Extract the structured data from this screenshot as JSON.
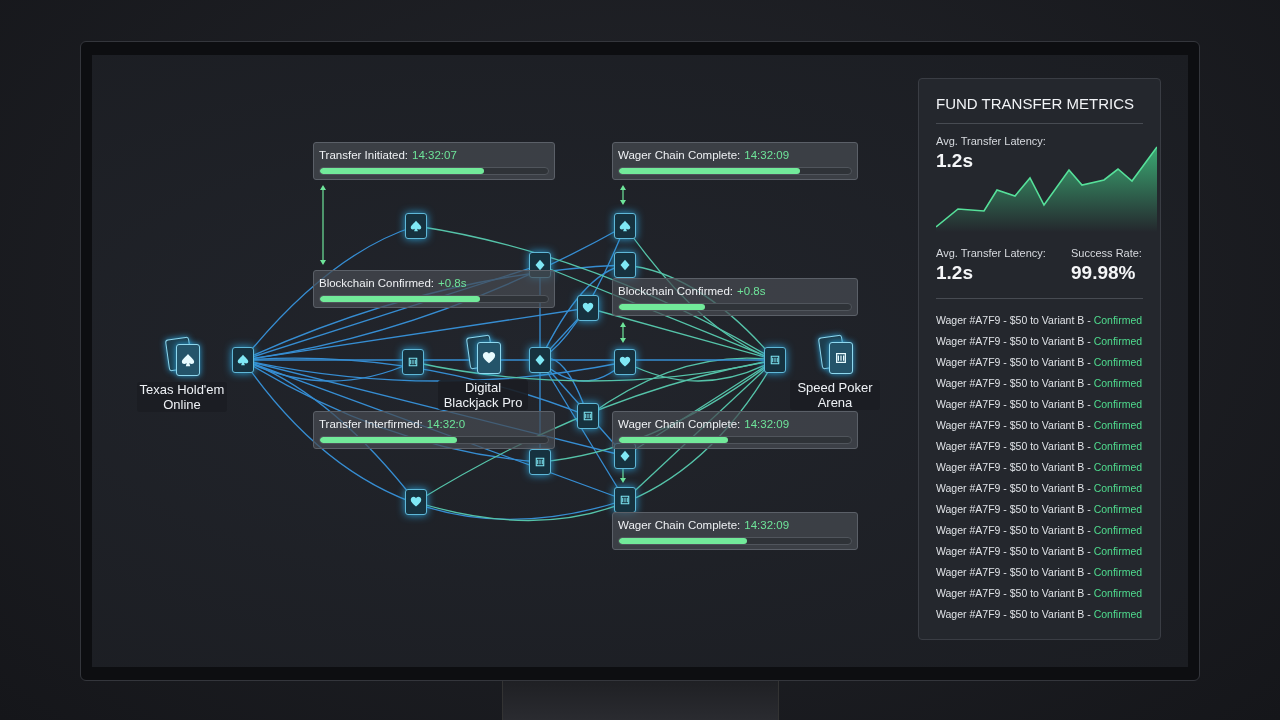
{
  "diagram": {
    "sources": [
      {
        "name": "Texas Hold'em Online"
      },
      {
        "name": "Digital Blackjack Pro"
      },
      {
        "name": "Speed Poker Arena"
      }
    ],
    "status_cards": [
      {
        "label": "Transfer Initiated:",
        "value": "14:32:07",
        "level": 0.72
      },
      {
        "label": "Wager Chain Complete:",
        "value": "14:32:09",
        "level": 0.78
      },
      {
        "label": "Blockchain Confirmed:",
        "value": "+0.8s",
        "level": 0.7
      },
      {
        "label": "Blockchain Confirmed:",
        "value": "+0.8s",
        "level": 0.37
      },
      {
        "label": "Transfer Interfirmed:",
        "value": "14:32:0",
        "level": 0.6
      },
      {
        "label": "Wager Chain Complete:",
        "value": "14:32:09",
        "level": 0.47
      },
      {
        "label": "Wager Chain Complete:",
        "value": "14:32:09",
        "level": 0.55
      }
    ]
  },
  "panel": {
    "title": "FUND TRANSFER METRICS",
    "hero_metric": {
      "label": "Avg. Transfer Latency:",
      "value": "1.2s"
    },
    "metrics": [
      {
        "label": "Avg. Transfer Latency:",
        "value": "1.2s"
      },
      {
        "label": "Success Rate:",
        "value": "99.98%"
      }
    ],
    "log": [
      {
        "text": "Wager #A7F9 - $50 to Variant B -",
        "status": "Confirmed"
      },
      {
        "text": "Wager #A7F9 - $50 to Variant B -",
        "status": "Confirmed"
      },
      {
        "text": "Wager #A7F9 - $50 to Variant B -",
        "status": "Confirmed"
      },
      {
        "text": "Wager #A7F9 - $50 to Variant B -",
        "status": "Confirmed"
      },
      {
        "text": "Wager #A7F9 - $50 to Variant B -",
        "status": "Confirmed"
      },
      {
        "text": "Wager #A7F9 - $50 to Variant B -",
        "status": "Confirmed"
      },
      {
        "text": "Wager #A7F9 - $50 to Variant B -",
        "status": "Confirmed"
      },
      {
        "text": "Wager #A7F9 - $50 to Variant B -",
        "status": "Confirmed"
      },
      {
        "text": "Wager #A7F9 - $50 to Variant B -",
        "status": "Confirmed"
      },
      {
        "text": "Wager #A7F9 - $50 to Variant B -",
        "status": "Confirmed"
      },
      {
        "text": "Wager #A7F9 - $50 to Variant B -",
        "status": "Confirmed"
      },
      {
        "text": "Wager #A7F9 - $50 to Variant B -",
        "status": "Confirmed"
      },
      {
        "text": "Wager #A7F9 - $50 to Variant B -",
        "status": "Confirmed"
      },
      {
        "text": "Wager #A7F9 - $50 to Variant B -",
        "status": "Confirmed"
      },
      {
        "text": "Wager #A7F9 - $50 to Variant B -",
        "status": "Confirmed"
      }
    ]
  }
}
